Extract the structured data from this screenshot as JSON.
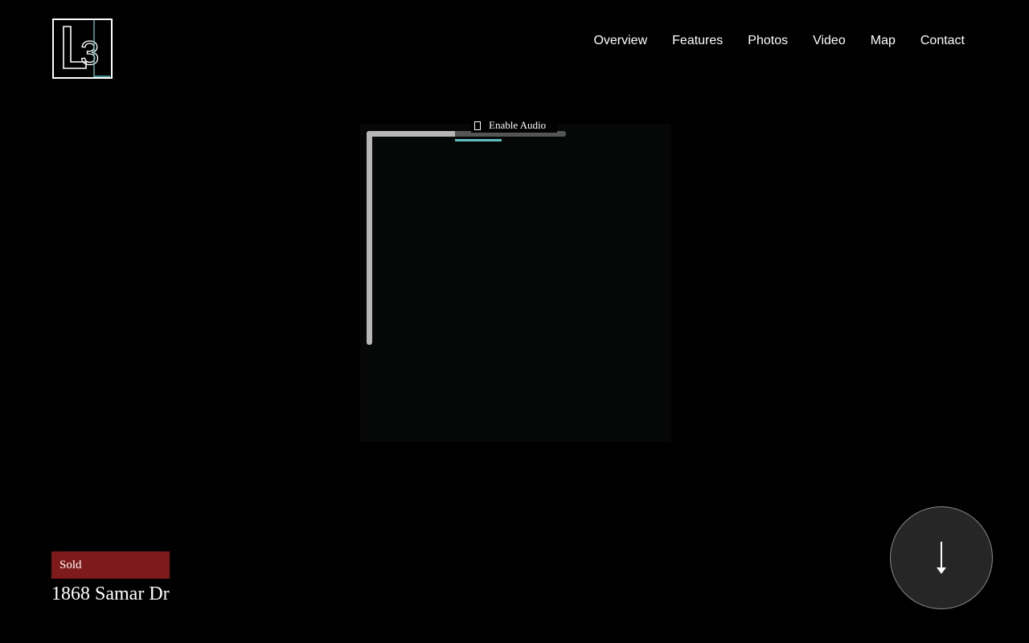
{
  "brand": {
    "logo_text": "L3",
    "accent_color": "#5fbec2"
  },
  "nav": {
    "items": [
      {
        "label": "Overview"
      },
      {
        "label": "Features"
      },
      {
        "label": "Photos"
      },
      {
        "label": "Video"
      },
      {
        "label": "Map"
      },
      {
        "label": "Contact"
      }
    ]
  },
  "video": {
    "audio_label": "Enable Audio",
    "audio_icon": "speaker-icon",
    "loading_icon": "loading-spinner-icon"
  },
  "listing": {
    "status": "Sold",
    "status_color": "#7f1a1a",
    "address": "1868 Samar Dr"
  },
  "scroll": {
    "icon": "arrow-down-icon"
  }
}
